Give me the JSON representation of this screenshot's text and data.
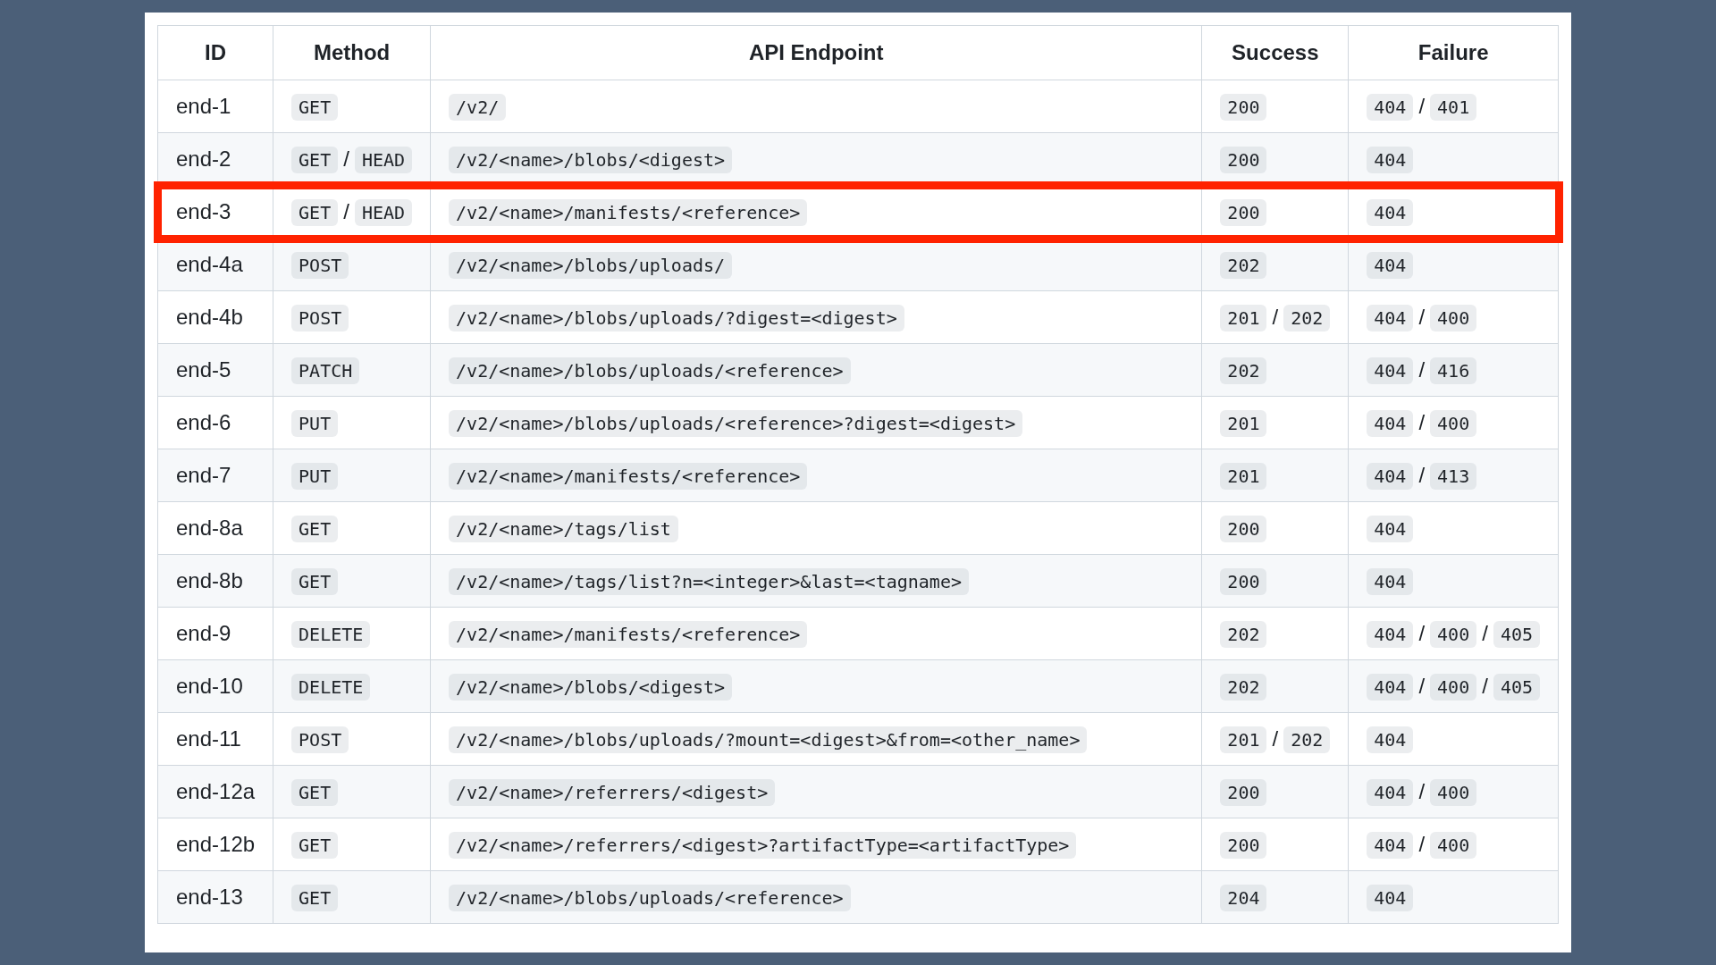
{
  "table": {
    "columns": [
      "ID",
      "Method",
      "API Endpoint",
      "Success",
      "Failure"
    ],
    "rows": [
      {
        "id": "end-1",
        "method": [
          {
            "kind": "code",
            "text": "GET"
          }
        ],
        "endpoint": "/v2/",
        "success": [
          {
            "kind": "code",
            "text": "200"
          }
        ],
        "failure": [
          {
            "kind": "code",
            "text": "404"
          },
          {
            "kind": "sep",
            "text": "/"
          },
          {
            "kind": "code",
            "text": "401"
          }
        ],
        "highlighted": false
      },
      {
        "id": "end-2",
        "method": [
          {
            "kind": "code",
            "text": "GET"
          },
          {
            "kind": "sep",
            "text": "/"
          },
          {
            "kind": "code",
            "text": "HEAD"
          }
        ],
        "endpoint": "/v2/<name>/blobs/<digest>",
        "success": [
          {
            "kind": "code",
            "text": "200"
          }
        ],
        "failure": [
          {
            "kind": "code",
            "text": "404"
          }
        ],
        "highlighted": false
      },
      {
        "id": "end-3",
        "method": [
          {
            "kind": "code",
            "text": "GET"
          },
          {
            "kind": "sep",
            "text": "/"
          },
          {
            "kind": "code",
            "text": "HEAD"
          }
        ],
        "endpoint": "/v2/<name>/manifests/<reference>",
        "success": [
          {
            "kind": "code",
            "text": "200"
          }
        ],
        "failure": [
          {
            "kind": "code",
            "text": "404"
          }
        ],
        "highlighted": true
      },
      {
        "id": "end-4a",
        "method": [
          {
            "kind": "code",
            "text": "POST"
          }
        ],
        "endpoint": "/v2/<name>/blobs/uploads/",
        "success": [
          {
            "kind": "code",
            "text": "202"
          }
        ],
        "failure": [
          {
            "kind": "code",
            "text": "404"
          }
        ],
        "highlighted": false
      },
      {
        "id": "end-4b",
        "method": [
          {
            "kind": "code",
            "text": "POST"
          }
        ],
        "endpoint": "/v2/<name>/blobs/uploads/?digest=<digest>",
        "success": [
          {
            "kind": "code",
            "text": "201"
          },
          {
            "kind": "sep",
            "text": "/"
          },
          {
            "kind": "code",
            "text": "202"
          }
        ],
        "failure": [
          {
            "kind": "code",
            "text": "404"
          },
          {
            "kind": "sep",
            "text": "/"
          },
          {
            "kind": "code",
            "text": "400"
          }
        ],
        "highlighted": false
      },
      {
        "id": "end-5",
        "method": [
          {
            "kind": "code",
            "text": "PATCH"
          }
        ],
        "endpoint": "/v2/<name>/blobs/uploads/<reference>",
        "success": [
          {
            "kind": "code",
            "text": "202"
          }
        ],
        "failure": [
          {
            "kind": "code",
            "text": "404"
          },
          {
            "kind": "sep",
            "text": "/"
          },
          {
            "kind": "code",
            "text": "416"
          }
        ],
        "highlighted": false
      },
      {
        "id": "end-6",
        "method": [
          {
            "kind": "code",
            "text": "PUT"
          }
        ],
        "endpoint": "/v2/<name>/blobs/uploads/<reference>?digest=<digest>",
        "success": [
          {
            "kind": "code",
            "text": "201"
          }
        ],
        "failure": [
          {
            "kind": "code",
            "text": "404"
          },
          {
            "kind": "sep",
            "text": "/"
          },
          {
            "kind": "code",
            "text": "400"
          }
        ],
        "highlighted": false
      },
      {
        "id": "end-7",
        "method": [
          {
            "kind": "code",
            "text": "PUT"
          }
        ],
        "endpoint": "/v2/<name>/manifests/<reference>",
        "success": [
          {
            "kind": "code",
            "text": "201"
          }
        ],
        "failure": [
          {
            "kind": "code",
            "text": "404"
          },
          {
            "kind": "sep",
            "text": "/"
          },
          {
            "kind": "code",
            "text": "413"
          }
        ],
        "highlighted": false
      },
      {
        "id": "end-8a",
        "method": [
          {
            "kind": "code",
            "text": "GET"
          }
        ],
        "endpoint": "/v2/<name>/tags/list",
        "success": [
          {
            "kind": "code",
            "text": "200"
          }
        ],
        "failure": [
          {
            "kind": "code",
            "text": "404"
          }
        ],
        "highlighted": false
      },
      {
        "id": "end-8b",
        "method": [
          {
            "kind": "code",
            "text": "GET"
          }
        ],
        "endpoint": "/v2/<name>/tags/list?n=<integer>&last=<tagname>",
        "success": [
          {
            "kind": "code",
            "text": "200"
          }
        ],
        "failure": [
          {
            "kind": "code",
            "text": "404"
          }
        ],
        "highlighted": false
      },
      {
        "id": "end-9",
        "method": [
          {
            "kind": "code",
            "text": "DELETE"
          }
        ],
        "endpoint": "/v2/<name>/manifests/<reference>",
        "success": [
          {
            "kind": "code",
            "text": "202"
          }
        ],
        "failure": [
          {
            "kind": "code",
            "text": "404"
          },
          {
            "kind": "sep",
            "text": "/"
          },
          {
            "kind": "code",
            "text": "400"
          },
          {
            "kind": "sep",
            "text": "/"
          },
          {
            "kind": "code",
            "text": "405"
          }
        ],
        "highlighted": false
      },
      {
        "id": "end-10",
        "method": [
          {
            "kind": "code",
            "text": "DELETE"
          }
        ],
        "endpoint": "/v2/<name>/blobs/<digest>",
        "success": [
          {
            "kind": "code",
            "text": "202"
          }
        ],
        "failure": [
          {
            "kind": "code",
            "text": "404"
          },
          {
            "kind": "sep",
            "text": "/"
          },
          {
            "kind": "code",
            "text": "400"
          },
          {
            "kind": "sep",
            "text": "/"
          },
          {
            "kind": "code",
            "text": "405"
          }
        ],
        "highlighted": false
      },
      {
        "id": "end-11",
        "method": [
          {
            "kind": "code",
            "text": "POST"
          }
        ],
        "endpoint": "/v2/<name>/blobs/uploads/?mount=<digest>&from=<other_name>",
        "success": [
          {
            "kind": "code",
            "text": "201"
          },
          {
            "kind": "sep",
            "text": "/"
          },
          {
            "kind": "code",
            "text": "202"
          }
        ],
        "failure": [
          {
            "kind": "code",
            "text": "404"
          }
        ],
        "highlighted": false
      },
      {
        "id": "end-12a",
        "method": [
          {
            "kind": "code",
            "text": "GET"
          }
        ],
        "endpoint": "/v2/<name>/referrers/<digest>",
        "success": [
          {
            "kind": "code",
            "text": "200"
          }
        ],
        "failure": [
          {
            "kind": "code",
            "text": "404"
          },
          {
            "kind": "sep",
            "text": "/"
          },
          {
            "kind": "code",
            "text": "400"
          }
        ],
        "highlighted": false
      },
      {
        "id": "end-12b",
        "method": [
          {
            "kind": "code",
            "text": "GET"
          }
        ],
        "endpoint": "/v2/<name>/referrers/<digest>?artifactType=<artifactType>",
        "success": [
          {
            "kind": "code",
            "text": "200"
          }
        ],
        "failure": [
          {
            "kind": "code",
            "text": "404"
          },
          {
            "kind": "sep",
            "text": "/"
          },
          {
            "kind": "code",
            "text": "400"
          }
        ],
        "highlighted": false
      },
      {
        "id": "end-13",
        "method": [
          {
            "kind": "code",
            "text": "GET"
          }
        ],
        "endpoint": "/v2/<name>/blobs/uploads/<reference>",
        "success": [
          {
            "kind": "code",
            "text": "204"
          }
        ],
        "failure": [
          {
            "kind": "code",
            "text": "404"
          }
        ],
        "highlighted": false
      }
    ]
  }
}
